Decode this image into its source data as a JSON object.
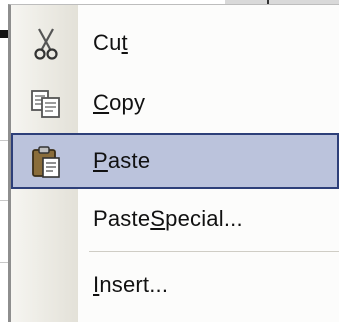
{
  "menu": {
    "items": [
      {
        "label_pre": "Cu",
        "label_accel": "t",
        "label_post": "",
        "icon": "scissors-icon",
        "highlighted": false
      },
      {
        "label_pre": "",
        "label_accel": "C",
        "label_post": "opy",
        "icon": "copy-icon",
        "highlighted": false
      },
      {
        "label_pre": "",
        "label_accel": "P",
        "label_post": "aste",
        "icon": "clipboard-paste-icon",
        "highlighted": true
      },
      {
        "label_pre": "Paste ",
        "label_accel": "S",
        "label_post": "pecial...",
        "icon": "",
        "highlighted": false
      },
      {
        "label_pre": "",
        "label_accel": "I",
        "label_post": "nsert...",
        "icon": "",
        "highlighted": false
      }
    ]
  },
  "colors": {
    "highlight_fill": "#bbc3dc",
    "highlight_border": "#2d3f79",
    "gutter": "#e9e7df"
  }
}
